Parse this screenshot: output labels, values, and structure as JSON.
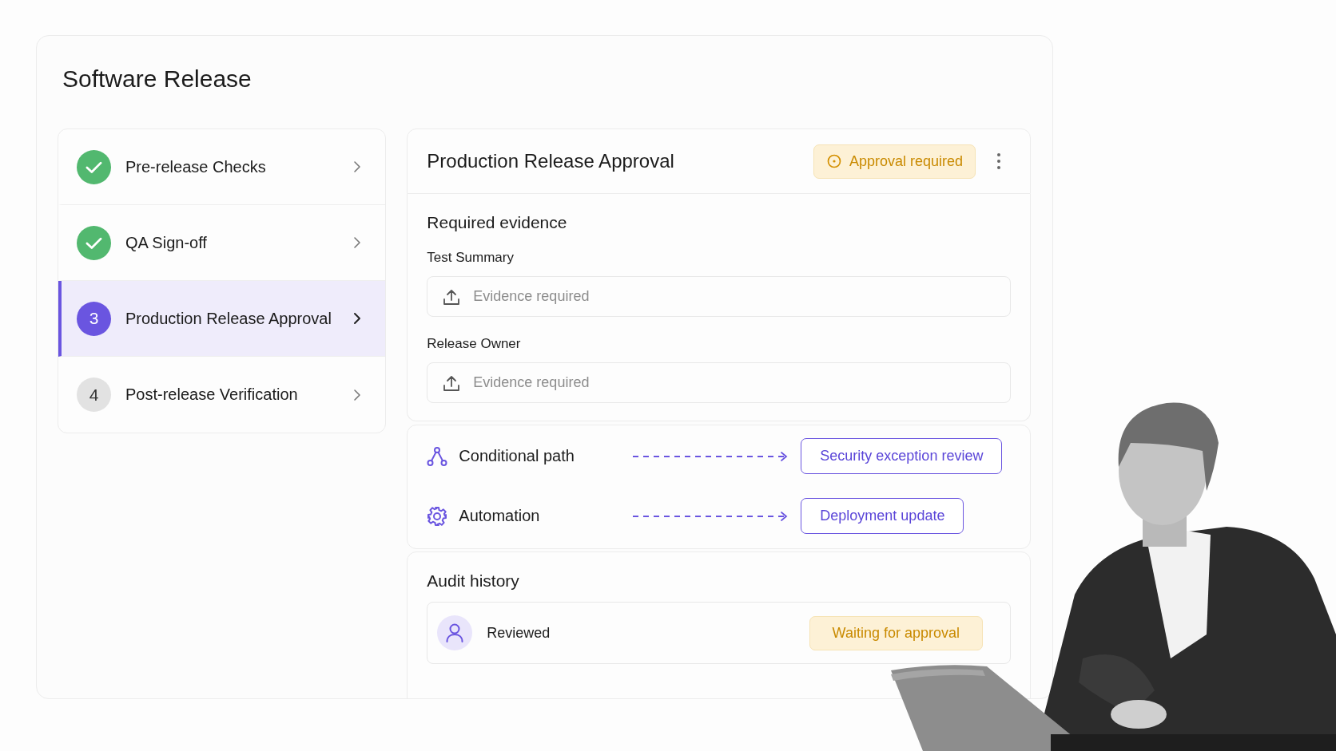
{
  "title": "Software Release",
  "steps": [
    {
      "label": "Pre-release Checks",
      "kind": "done",
      "selected": false
    },
    {
      "label": "QA Sign-off",
      "kind": "done",
      "selected": false
    },
    {
      "label": "Production Release Approval",
      "number": "3",
      "kind": "current",
      "selected": true
    },
    {
      "label": "Post-release Verification",
      "number": "4",
      "kind": "pending",
      "selected": false
    }
  ],
  "detail": {
    "title": "Production Release Approval",
    "badge": "Approval required",
    "evidence": {
      "heading": "Required evidence",
      "fields": [
        {
          "label": "Test Summary",
          "placeholder": "Evidence required"
        },
        {
          "label": "Release Owner",
          "placeholder": "Evidence required"
        }
      ]
    },
    "routes": [
      {
        "kind": "conditional",
        "label": "Conditional path",
        "target": "Security exception review"
      },
      {
        "kind": "automation",
        "label": "Automation",
        "target": "Deployment update"
      }
    ],
    "audit": {
      "heading": "Audit history",
      "entries": [
        {
          "label": "Reviewed",
          "status": "Waiting for approval"
        }
      ]
    }
  }
}
